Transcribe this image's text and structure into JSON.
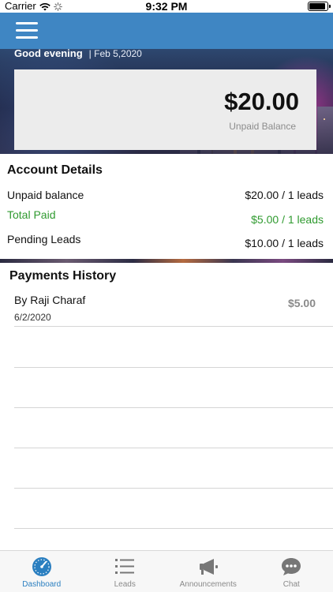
{
  "status": {
    "carrier": "Carrier",
    "time": "9:32 PM"
  },
  "header": {
    "greeting": "Good evening",
    "date": "| Feb 5,2020"
  },
  "balance": {
    "amount": "$20.00",
    "label": "Unpaid Balance"
  },
  "account": {
    "title": "Account Details",
    "rows": [
      {
        "label": "Unpaid balance",
        "value": "$20.00 / 1 leads"
      },
      {
        "label": "Total Paid",
        "value": "$5.00 / 1 leads"
      },
      {
        "label": "Pending Leads",
        "value": "$10.00 / 1 leads"
      }
    ]
  },
  "payments": {
    "title": "Payments History",
    "items": [
      {
        "by": "By Raji Charaf",
        "date": "6/2/2020",
        "amount": "$5.00"
      }
    ]
  },
  "tabs": [
    {
      "label": "Dashboard",
      "icon": "dashboard-gauge-icon",
      "active": true
    },
    {
      "label": "Leads",
      "icon": "list-icon",
      "active": false
    },
    {
      "label": "Announcements",
      "icon": "megaphone-icon",
      "active": false
    },
    {
      "label": "Chat",
      "icon": "chat-bubble-icon",
      "active": false
    }
  ],
  "colors": {
    "nav": "#3f86c3",
    "active_tab": "#2b7fc0",
    "paid_green": "#2f9a2f",
    "inactive_tab": "#8a8a8a"
  }
}
